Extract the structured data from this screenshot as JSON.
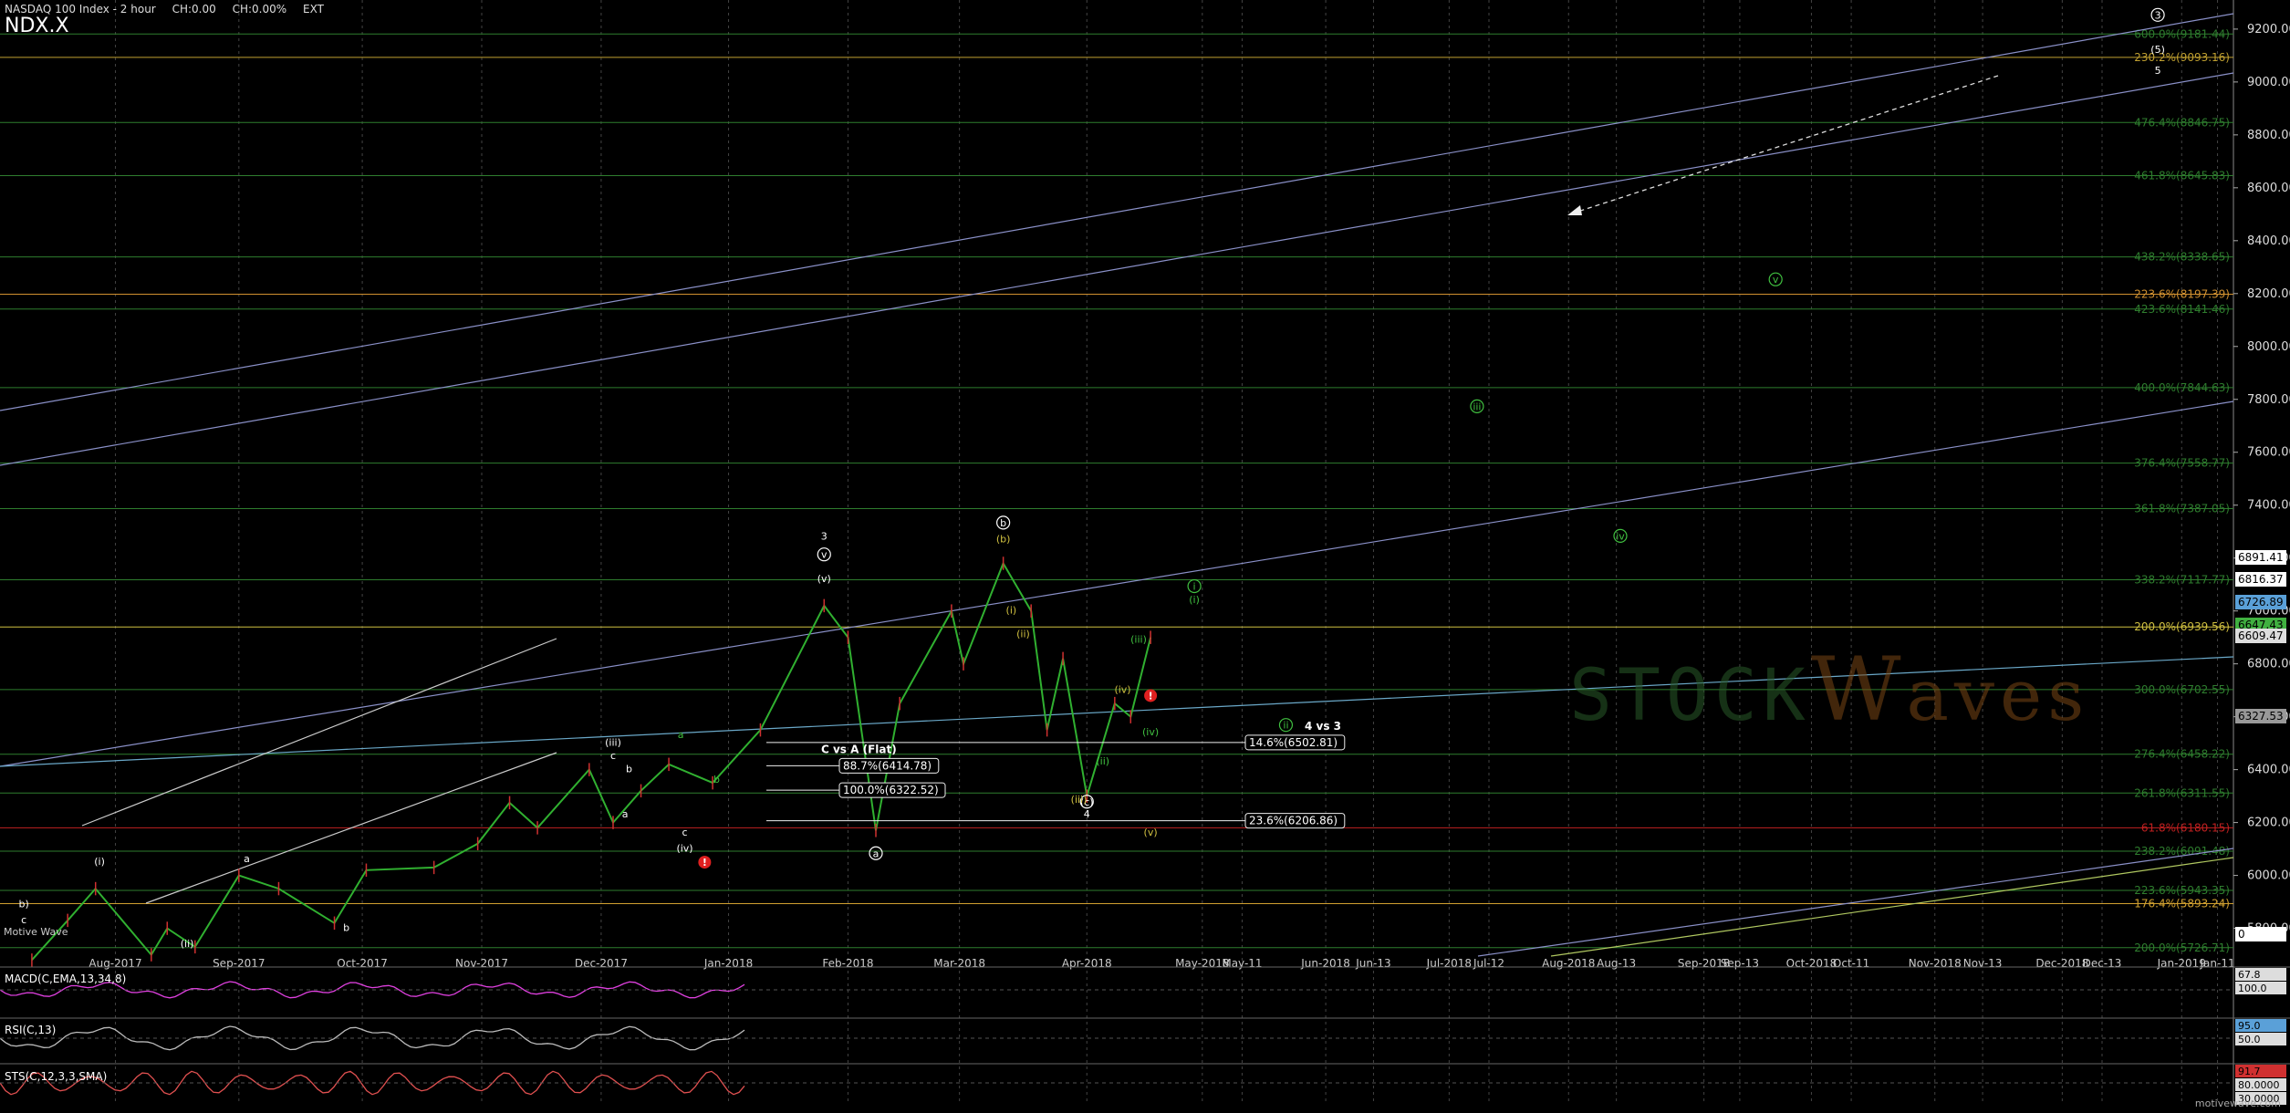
{
  "header": {
    "index_name": "NASDAQ 100 Index - 2 hour",
    "change": "CH:0.00",
    "change_pct": "CH:0.00%",
    "session": "EXT",
    "symbol": "NDX.X"
  },
  "credits": {
    "left": "Motive Wave",
    "right": "motivewave.com"
  },
  "watermark": {
    "text": "STOCK",
    "w": "W",
    "rest": "aves"
  },
  "chart_data": [
    {
      "type": "line",
      "title": "NASDAQ 100 Index - 2 hour",
      "x_tick_labels": [
        "Aug-2017",
        "Sep-2017",
        "Oct-2017",
        "Nov-2017",
        "Dec-2017",
        "Jan-2018",
        "Feb-2018",
        "Mar-2018",
        "Apr-2018",
        "May-2018",
        "May-11",
        "Jun-2018",
        "Jun-13",
        "Jul-2018",
        "Jul-12",
        "Aug-2018",
        "Aug-13",
        "Sep-2018",
        "Sep-13",
        "Oct-2018",
        "Oct-11",
        "Nov-2018",
        "Nov-13",
        "Dec-2018",
        "Dec-13",
        "Jan-2019",
        "Jan-11"
      ],
      "y_tick_labels": [
        "9200.00",
        "9000.00",
        "8800.00",
        "8600.00",
        "8400.00",
        "8200.00",
        "8000.00",
        "7800.00",
        "7600.00",
        "7400.00",
        "7200.00",
        "7000.00",
        "6800.00",
        "6600.00",
        "6400.00",
        "6200.00",
        "6000.00",
        "5800.00"
      ],
      "ylim": [
        5695,
        9310
      ],
      "grid": true,
      "price_series": [
        [
          "2017-07-11",
          5680
        ],
        [
          "2017-07-20",
          5830
        ],
        [
          "2017-07-27",
          5950
        ],
        [
          "2017-08-10",
          5700
        ],
        [
          "2017-08-14",
          5800
        ],
        [
          "2017-08-21",
          5730
        ],
        [
          "2017-09-01",
          6000
        ],
        [
          "2017-09-11",
          5950
        ],
        [
          "2017-09-25",
          5820
        ],
        [
          "2017-10-03",
          6020
        ],
        [
          "2017-10-20",
          6030
        ],
        [
          "2017-10-31",
          6120
        ],
        [
          "2017-11-08",
          6275
        ],
        [
          "2017-11-15",
          6180
        ],
        [
          "2017-11-28",
          6400
        ],
        [
          "2017-12-04",
          6200
        ],
        [
          "2017-12-11",
          6320
        ],
        [
          "2017-12-18",
          6420
        ],
        [
          "2017-12-29",
          6350
        ],
        [
          "2018-01-10",
          6550
        ],
        [
          "2018-01-26",
          7020
        ],
        [
          "2018-02-01",
          6900
        ],
        [
          "2018-02-08",
          6170
        ],
        [
          "2018-02-14",
          6650
        ],
        [
          "2018-02-27",
          7000
        ],
        [
          "2018-03-02",
          6800
        ],
        [
          "2018-03-12",
          7180
        ],
        [
          "2018-03-19",
          7000
        ],
        [
          "2018-03-23",
          6550
        ],
        [
          "2018-03-27",
          6820
        ],
        [
          "2018-04-02",
          6300
        ],
        [
          "2018-04-09",
          6650
        ],
        [
          "2018-04-13",
          6600
        ],
        [
          "2018-04-18",
          6900
        ]
      ],
      "fib_levels": [
        {
          "label": "600.0%(9181.44)",
          "value": 9181.44,
          "color": "#2e7d2e"
        },
        {
          "label": "230.2%(9093.16)",
          "value": 9093.16,
          "color": "#c0a030"
        },
        {
          "label": "476.4%(8846.75)",
          "value": 8846.75,
          "color": "#2e7d2e"
        },
        {
          "label": "461.8%(8645.83)",
          "value": 8645.83,
          "color": "#2e7d2e"
        },
        {
          "label": "438.2%(8338.65)",
          "value": 8338.65,
          "color": "#2e7d2e"
        },
        {
          "label": "223.6%(8197.39)",
          "value": 8197.39,
          "color": "#d09030"
        },
        {
          "label": "423.6%(8141.46)",
          "value": 8141.46,
          "color": "#2e7d2e"
        },
        {
          "label": "400.0%(7844.63)",
          "value": 7844.63,
          "color": "#2e7d2e"
        },
        {
          "label": "376.4%(7558.77)",
          "value": 7558.77,
          "color": "#2e7d2e"
        },
        {
          "label": "361.8%(7387.05)",
          "value": 7387.05,
          "color": "#2e7d2e"
        },
        {
          "label": "338.2%(7117.77)",
          "value": 7117.77,
          "color": "#2e7d2e"
        },
        {
          "label": "200.0%(6939.56)",
          "value": 6939.56,
          "color": "#d0c040"
        },
        {
          "label": "300.0%(6702.55)",
          "value": 6702.55,
          "color": "#2e7d2e"
        },
        {
          "label": "276.4%(6458.22)",
          "value": 6458.22,
          "color": "#2e7d2e"
        },
        {
          "label": "261.8%(6311.55)",
          "value": 6311.55,
          "color": "#2e7d2e"
        },
        {
          "label": "61.8%(6180.15)",
          "value": 6180.15,
          "color": "#c02020"
        },
        {
          "label": "238.2%(6091.48)",
          "value": 6091.48,
          "color": "#2e7d2e"
        },
        {
          "label": "223.6%(5943.35)",
          "value": 5943.35,
          "color": "#2e7d2e"
        },
        {
          "label": "176.4%(5893.24)",
          "value": 5893.24,
          "color": "#d0a030"
        },
        {
          "label": "200.0%(5726.71)",
          "value": 5726.71,
          "color": "#2e7d2e"
        }
      ],
      "price_tags": [
        {
          "label": "6891.41",
          "color": "#ffffff"
        },
        {
          "label": "6816.37",
          "color": "#ffffff"
        },
        {
          "label": "6726.89",
          "color": "#5aa0d8"
        },
        {
          "label": "6647.43",
          "color": "#40b040"
        },
        {
          "label": "6609.47",
          "color": "#dddddd"
        },
        {
          "label": "6327.53",
          "color": "#999999"
        },
        {
          "label": "0",
          "color": "#ffffff"
        }
      ],
      "retracement_boxes": [
        {
          "title": "4 vs 3",
          "label": "14.6%(6502.81)",
          "value": 6502.81
        },
        {
          "title": "C vs A (Flat)",
          "label": "88.7%(6414.78)",
          "value": 6414.78
        },
        {
          "label": "100.0%(6322.52)",
          "value": 6322.52
        },
        {
          "label": "23.6%(6206.86)",
          "value": 6206.86
        }
      ],
      "wave_labels": [
        {
          "text": "3",
          "date": "2018-01-26",
          "value": 7270,
          "color": "#ffffff",
          "circle": false
        },
        {
          "text": "v",
          "date": "2018-01-26",
          "value": 7200,
          "color": "#ffffff",
          "circle": true
        },
        {
          "text": "(v)",
          "date": "2018-01-26",
          "value": 7110,
          "color": "#ffffff",
          "circle": false
        },
        {
          "text": "a",
          "date": "2018-02-08",
          "value": 6070,
          "color": "#ffffff",
          "circle": true
        },
        {
          "text": "b",
          "date": "2018-03-12",
          "value": 7320,
          "color": "#ffffff",
          "circle": true
        },
        {
          "text": "(b)",
          "date": "2018-03-12",
          "value": 7260,
          "color": "#d0c040",
          "circle": false
        },
        {
          "text": "(i)",
          "date": "2018-03-14",
          "value": 6990,
          "color": "#d0c040",
          "circle": false
        },
        {
          "text": "(ii)",
          "date": "2018-03-17",
          "value": 6900,
          "color": "#d0c040",
          "circle": false
        },
        {
          "text": "(c)",
          "date": "2018-04-02",
          "value": 6265,
          "color": "#ffffff",
          "circle": true
        },
        {
          "text": "4",
          "date": "2018-04-02",
          "value": 6220,
          "color": "#ffffff",
          "circle": false
        },
        {
          "text": "(iii)",
          "date": "2018-03-31",
          "value": 6275,
          "color": "#d0c040",
          "circle": false
        },
        {
          "text": "(v)",
          "date": "2018-04-18",
          "value": 6150,
          "color": "#d0c040",
          "circle": false
        },
        {
          "text": "(iii)",
          "date": "2018-04-15",
          "value": 6880,
          "color": "#40c040",
          "circle": false
        },
        {
          "text": "(iv)",
          "date": "2018-04-11",
          "value": 6690,
          "color": "#d0c040",
          "circle": false
        },
        {
          "text": "(ii)",
          "date": "2018-04-06",
          "value": 6420,
          "color": "#40c040",
          "circle": false
        },
        {
          "text": "(iv)",
          "date": "2018-04-18",
          "value": 6530,
          "color": "#40c040",
          "circle": false
        },
        {
          "text": "i",
          "date": "2018-04-29",
          "value": 7080,
          "color": "#40c040",
          "circle": true
        },
        {
          "text": "(i)",
          "date": "2018-04-29",
          "value": 7030,
          "color": "#40c040",
          "circle": false
        },
        {
          "text": "ii",
          "date": "2018-05-22",
          "value": 6555,
          "color": "#40c040",
          "circle": true
        },
        {
          "text": "iii",
          "date": "2018-07-09",
          "value": 7760,
          "color": "#40c040",
          "circle": true
        },
        {
          "text": "iv",
          "date": "2018-08-14",
          "value": 7270,
          "color": "#40c040",
          "circle": true
        },
        {
          "text": "v",
          "date": "2018-09-22",
          "value": 8240,
          "color": "#40c040",
          "circle": true
        },
        {
          "text": "3",
          "date": "2018-12-27",
          "value": 9240,
          "color": "#ffffff",
          "circle": true
        },
        {
          "text": "(5)",
          "date": "2018-12-27",
          "value": 9110,
          "color": "#ffffff",
          "circle": false
        },
        {
          "text": "5",
          "date": "2018-12-27",
          "value": 9030,
          "color": "#ffffff",
          "circle": false
        },
        {
          "text": "(i)",
          "date": "2017-07-28",
          "value": 6040,
          "color": "#ffffff",
          "circle": false
        },
        {
          "text": "(ii)",
          "date": "2017-08-19",
          "value": 5730,
          "color": "#ffffff",
          "circle": false
        },
        {
          "text": "a",
          "date": "2017-09-03",
          "value": 6050,
          "color": "#ffffff",
          "circle": false
        },
        {
          "text": "b",
          "date": "2017-09-28",
          "value": 5790,
          "color": "#ffffff",
          "circle": false
        },
        {
          "text": "(iii)",
          "date": "2017-12-04",
          "value": 6490,
          "color": "#ffffff",
          "circle": false
        },
        {
          "text": "c",
          "date": "2017-12-04",
          "value": 6440,
          "color": "#ffffff",
          "circle": false
        },
        {
          "text": "b",
          "date": "2017-12-08",
          "value": 6390,
          "color": "#ffffff",
          "circle": false
        },
        {
          "text": "a",
          "date": "2017-12-07",
          "value": 6220,
          "color": "#ffffff",
          "circle": false
        },
        {
          "text": "c",
          "date": "2017-12-22",
          "value": 6150,
          "color": "#ffffff",
          "circle": false
        },
        {
          "text": "(iv)",
          "date": "2017-12-22",
          "value": 6090,
          "color": "#ffffff",
          "circle": false
        },
        {
          "text": "a",
          "date": "2017-12-21",
          "value": 6520,
          "color": "#40c040",
          "circle": false
        },
        {
          "text": "b",
          "date": "2017-12-30",
          "value": 6350,
          "color": "#40c040",
          "circle": false
        },
        {
          "text": "b)",
          "date": "2017-07-09",
          "value": 5880,
          "color": "#ffffff",
          "circle": false
        },
        {
          "text": "c",
          "date": "2017-07-09",
          "value": 5820,
          "color": "#ffffff",
          "circle": false
        }
      ]
    },
    {
      "type": "line",
      "title": "MACD(C,EMA,13,34,8)",
      "tags": [
        {
          "label": "67.8",
          "color": "#dddddd"
        },
        {
          "label": "100.0",
          "color": "#dddddd"
        }
      ]
    },
    {
      "type": "line",
      "title": "RSI(C,13)",
      "tags": [
        {
          "label": "95.0",
          "color": "#5aa0d8"
        },
        {
          "label": "50.0",
          "color": "#dddddd"
        }
      ]
    },
    {
      "type": "line",
      "title": "STS(C,12,3,3,SMA)",
      "tags": [
        {
          "label": "91.7",
          "color": "#d03030"
        },
        {
          "label": "80.0000",
          "color": "#dddddd"
        },
        {
          "label": "30.0000",
          "color": "#dddddd"
        }
      ]
    }
  ]
}
